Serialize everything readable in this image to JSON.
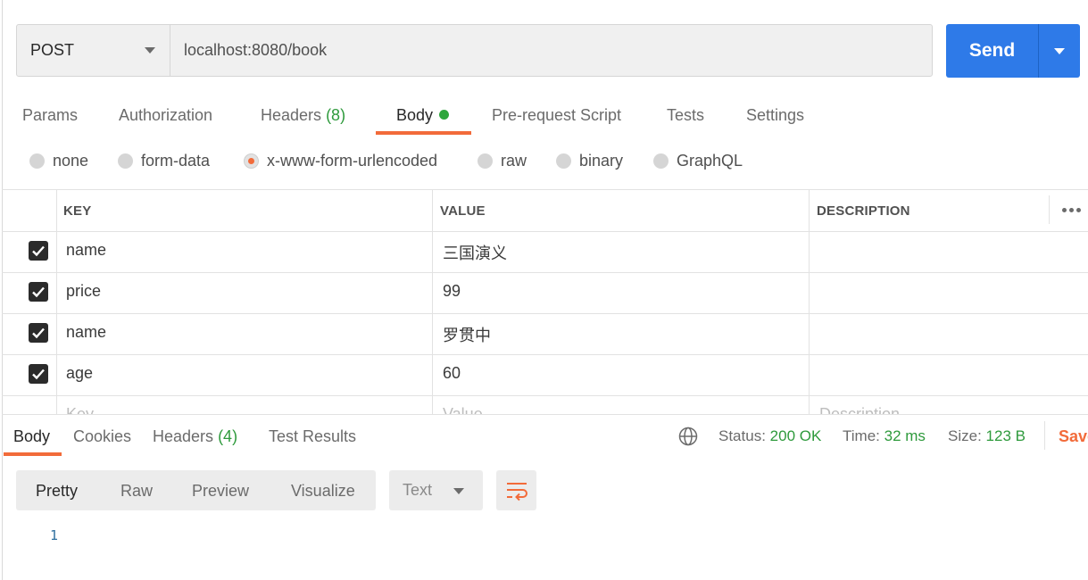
{
  "request": {
    "method": "POST",
    "url": "localhost:8080/book",
    "send_label": "Send"
  },
  "tabs": [
    {
      "label": "Params"
    },
    {
      "label": "Authorization"
    },
    {
      "label": "Headers",
      "count": "(8)"
    },
    {
      "label": "Body",
      "active": true
    },
    {
      "label": "Pre-request Script"
    },
    {
      "label": "Tests"
    },
    {
      "label": "Settings"
    }
  ],
  "body_types": [
    {
      "label": "none"
    },
    {
      "label": "form-data"
    },
    {
      "label": "x-www-form-urlencoded",
      "selected": true
    },
    {
      "label": "raw"
    },
    {
      "label": "binary"
    },
    {
      "label": "GraphQL"
    }
  ],
  "table": {
    "headers": {
      "key": "KEY",
      "value": "VALUE",
      "description": "DESCRIPTION"
    },
    "rows": [
      {
        "checked": true,
        "key": "name",
        "value": "三国演义",
        "description": ""
      },
      {
        "checked": true,
        "key": "price",
        "value": "99",
        "description": ""
      },
      {
        "checked": true,
        "key": "name",
        "value": "罗贯中",
        "description": ""
      },
      {
        "checked": true,
        "key": "age",
        "value": "60",
        "description": ""
      }
    ],
    "placeholders": {
      "key": "Key",
      "value": "Value",
      "description": "Description"
    }
  },
  "response": {
    "tabs": [
      {
        "label": "Body",
        "active": true
      },
      {
        "label": "Cookies"
      },
      {
        "label": "Headers",
        "count": "(4)"
      },
      {
        "label": "Test Results"
      }
    ],
    "status_label": "Status:",
    "status_value": "200 OK",
    "time_label": "Time:",
    "time_value": "32 ms",
    "size_label": "Size:",
    "size_value": "123 B",
    "save_label": "Save",
    "view_modes": [
      "Pretty",
      "Raw",
      "Preview",
      "Visualize"
    ],
    "active_view": "Pretty",
    "format": "Text",
    "line_numbers": [
      "1"
    ]
  },
  "colors": {
    "accent": "#f26b3a",
    "send": "#2e7ae8",
    "success": "#2e9a3c"
  },
  "icons": [
    "chevron-down-icon",
    "green-dot-icon",
    "checkbox-checked-icon",
    "more-dots-icon",
    "globe-icon",
    "wrap-lines-icon"
  ]
}
